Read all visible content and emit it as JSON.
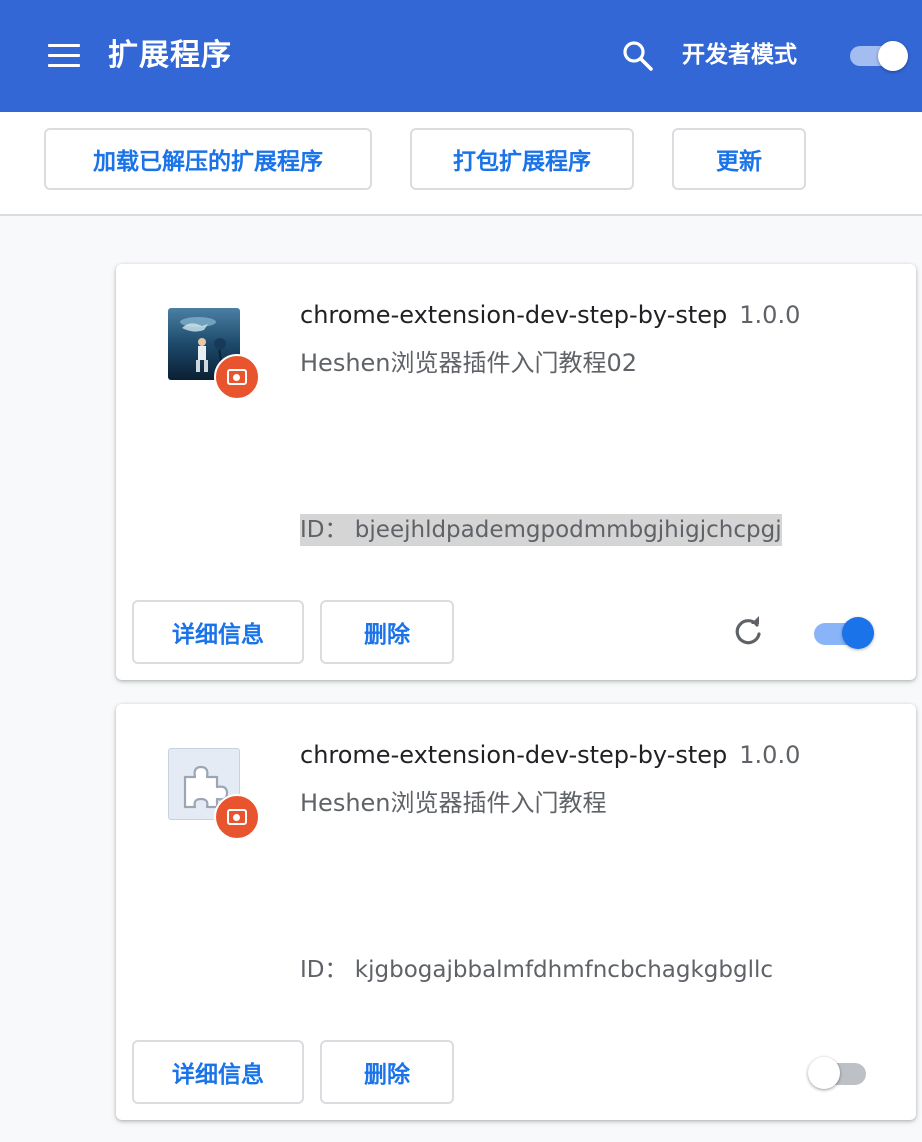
{
  "header": {
    "title": "扩展程序",
    "search_icon": "search-icon",
    "devmode_label": "开发者模式",
    "devmode_enabled": true
  },
  "toolbar": {
    "load_unpacked_label": "加载已解压的扩展程序",
    "pack_label": "打包扩展程序",
    "update_label": "更新"
  },
  "extensions": [
    {
      "name": "chrome-extension-dev-step-by-step",
      "version": "1.0.0",
      "description": "Heshen浏览器插件入门教程02",
      "id_text": "ID： bjeejhldpademgpodmmbgjhigjchcpgj",
      "details_label": "详细信息",
      "remove_label": "删除",
      "icon": "custom-image-icon",
      "enabled": true,
      "has_reload": true
    },
    {
      "name": "chrome-extension-dev-step-by-step",
      "version": "1.0.0",
      "description": "Heshen浏览器插件入门教程",
      "id_text": "ID： kjgbogajbbalmfdhmfncbchagkgbgllc",
      "details_label": "详细信息",
      "remove_label": "删除",
      "icon": "puzzle-piece-icon",
      "enabled": false,
      "has_reload": false
    }
  ],
  "colors": {
    "header_bg": "#3367d6",
    "accent": "#1a73e8",
    "badge": "#e8542e"
  }
}
